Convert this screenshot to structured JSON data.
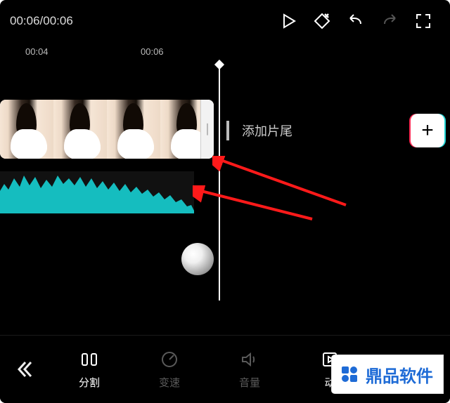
{
  "topbar": {
    "timecode": "00:06/00:06"
  },
  "ruler": {
    "marks": [
      "00:04",
      "00:06"
    ]
  },
  "timeline": {
    "add_tail_label": "添加片尾",
    "add_button_symbol": "+"
  },
  "toolbar": {
    "split": "分割",
    "speed": "变速",
    "volume": "音量",
    "anim_partial": "动",
    "crop": ""
  },
  "watermark": {
    "text": "鼎品软件"
  }
}
